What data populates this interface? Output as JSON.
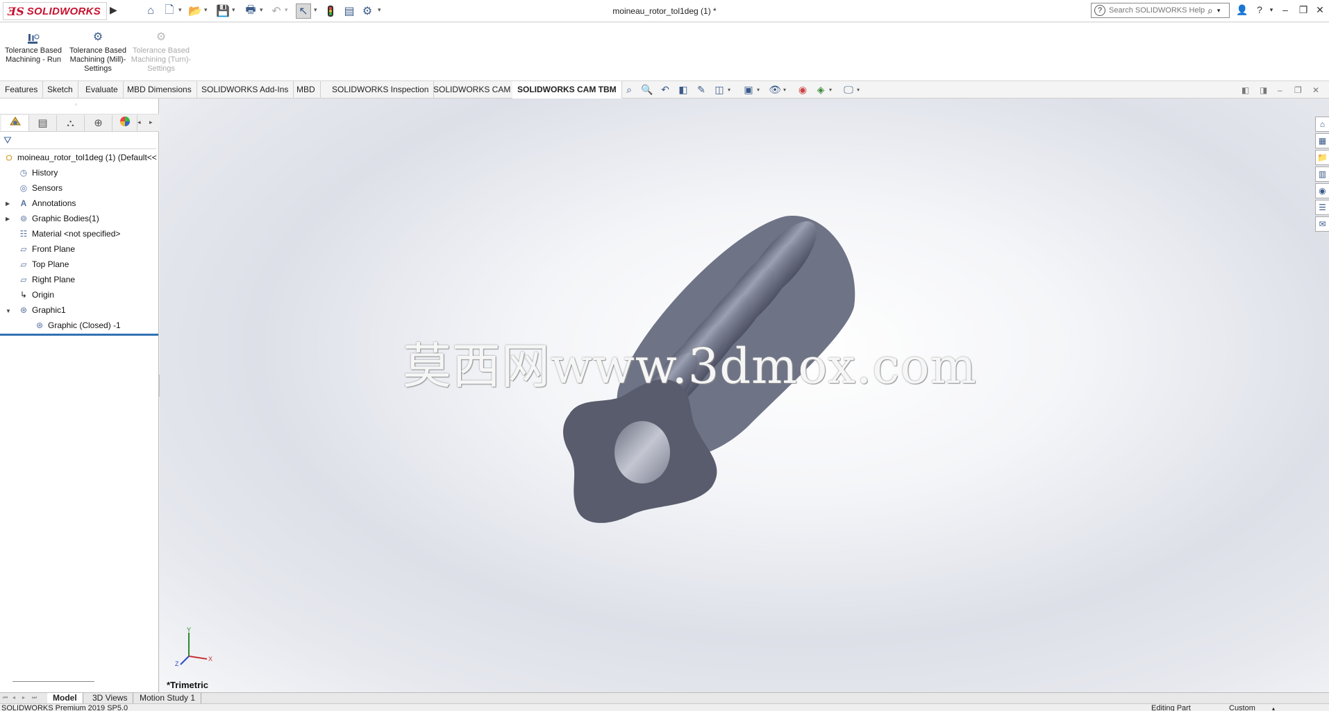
{
  "titlebar": {
    "logo_text": "SOLIDWORKS",
    "document_title": "moineau_rotor_tol1deg (1) *",
    "search_placeholder": "Search SOLIDWORKS Help"
  },
  "command_manager": {
    "buttons": [
      {
        "label": "Tolerance Based Machining - Run",
        "icon": "tbm-run-icon",
        "enabled": true
      },
      {
        "label": "Tolerance Based Machining (Mill)- Settings",
        "icon": "gear-icon",
        "enabled": true
      },
      {
        "label": "Tolerance Based Machining (Turn)- Settings",
        "icon": "gear-icon",
        "enabled": false
      }
    ]
  },
  "tabs": {
    "items": [
      {
        "label": "Features"
      },
      {
        "label": "Sketch"
      },
      {
        "label": "Evaluate"
      },
      {
        "label": "MBD Dimensions"
      },
      {
        "label": "SOLIDWORKS Add-Ins"
      },
      {
        "label": "MBD"
      },
      {
        "label": "SOLIDWORKS Inspection"
      },
      {
        "label": "SOLIDWORKS CAM"
      },
      {
        "label": "SOLIDWORKS CAM TBM"
      }
    ],
    "active": "SOLIDWORKS CAM TBM"
  },
  "feature_tree": {
    "root": "moineau_rotor_tol1deg (1)  (Default<<",
    "items": [
      {
        "label": "History",
        "icon": "history-folder-icon"
      },
      {
        "label": "Sensors",
        "icon": "sensors-icon"
      },
      {
        "label": "Annotations",
        "icon": "annotations-icon"
      },
      {
        "label": "Graphic Bodies(1)",
        "icon": "graphic-bodies-icon"
      },
      {
        "label": "Material <not specified>",
        "icon": "material-icon"
      },
      {
        "label": "Front Plane",
        "icon": "plane-icon"
      },
      {
        "label": "Top Plane",
        "icon": "plane-icon"
      },
      {
        "label": "Right Plane",
        "icon": "plane-icon"
      },
      {
        "label": "Origin",
        "icon": "origin-icon"
      },
      {
        "label": "Graphic1",
        "icon": "graphic-body-icon"
      },
      {
        "label": "Graphic (Closed) -1",
        "icon": "graphic-body-icon"
      }
    ]
  },
  "viewport": {
    "watermark": "莫西网www.3dmox.com",
    "view_orientation": "*Trimetric",
    "triad_labels": {
      "x": "X",
      "y": "Y",
      "z": "Z"
    }
  },
  "bottom_tabs": {
    "items": [
      {
        "label": "Model"
      },
      {
        "label": "3D Views"
      },
      {
        "label": "Motion Study 1"
      }
    ],
    "active": "Model"
  },
  "statusbar": {
    "product": "SOLIDWORKS Premium 2019 SP5.0",
    "mode": "Editing Part",
    "units": "Custom"
  },
  "colors": {
    "brand_red": "#c8102e",
    "selection_blue": "#3072b3",
    "model_gray": "#7a7f90"
  }
}
